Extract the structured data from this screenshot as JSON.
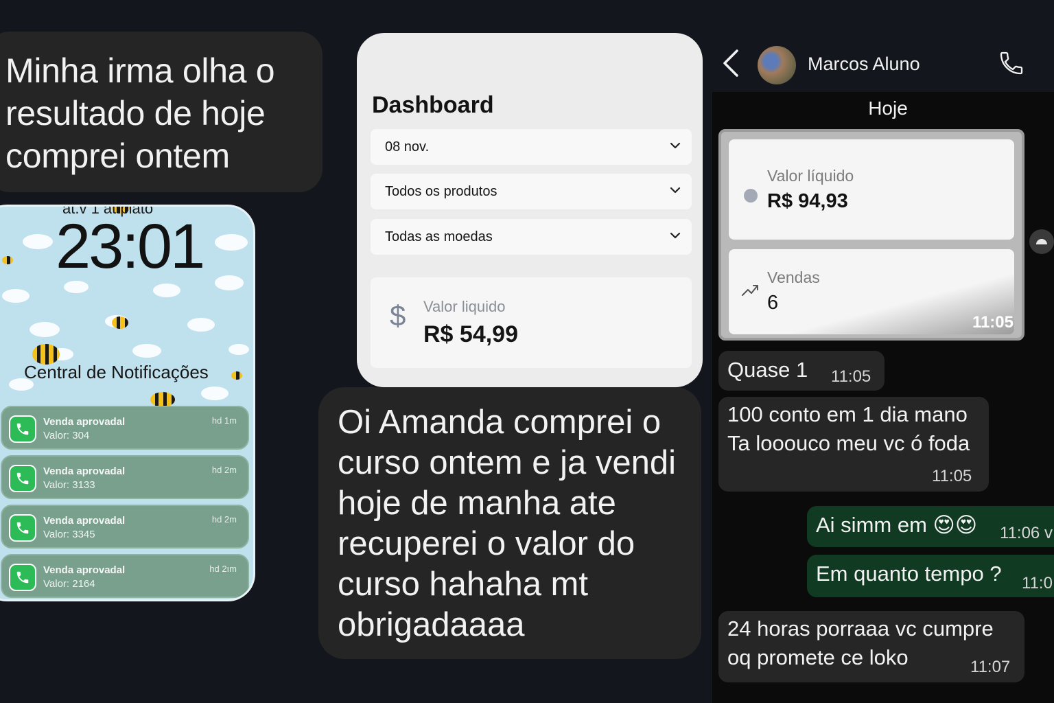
{
  "left_bubble": {
    "lines": [
      "Minha irma olha o",
      "resultado de hoje",
      "comprei ontem"
    ]
  },
  "lock_screen": {
    "date_partial": "at.v 1 at.plato",
    "time": "23:01",
    "notifications_title": "Central de Notificações",
    "notifications": [
      {
        "title": "Venda aprovadal",
        "value": "Valor: 304",
        "time": "hd 1m",
        "icon": "phone-icon"
      },
      {
        "title": "Venda aprovadal",
        "value": "Valor: 3133",
        "time": "hd 2m",
        "icon": "phone-icon"
      },
      {
        "title": "Venda aprovadal",
        "value": "Valor: 3345",
        "time": "hd 2m",
        "icon": "phone-icon"
      },
      {
        "title": "Venda aprovadal",
        "value": "Valor: 2164",
        "time": "hd 2ım",
        "icon": "phone-icon"
      }
    ]
  },
  "dashboard": {
    "title": "Dashboard",
    "filters": {
      "date": "08 nov.",
      "products": "Todos os produtos",
      "currencies": "Todas as moedas"
    },
    "value_card": {
      "icon": "$",
      "label": "Valor liquido",
      "amount": "R$ 54,99"
    }
  },
  "mid_bubble": {
    "lines": [
      "Oi Amanda comprei o",
      "curso ontem e ja vendi",
      "hoje de manha ate",
      "recuperei o valor do",
      "curso hahaha mt",
      "obrigadaaaa"
    ]
  },
  "chat": {
    "contact_name": "Marcos Aluno",
    "day_label": "Hoje",
    "image_message": {
      "net_label": "Valor líquido",
      "net_value": "R$ 94,93",
      "sales_label": "Vendas",
      "sales_value": "6",
      "time": "11:05"
    },
    "messages": [
      {
        "text": "Quase 1",
        "time": "11:05",
        "dir": "in"
      },
      {
        "line1": "100 conto em 1 dia mano",
        "line2": "Ta looouco meu vc ó foda",
        "time": "11:05",
        "dir": "in"
      },
      {
        "text": "Ai simm em 😍😍",
        "time": "11:06 v",
        "dir": "out"
      },
      {
        "text": "Em quanto tempo ?",
        "time": "11:0",
        "dir": "out"
      },
      {
        "line1": "24 horas porraaa vc cumpre",
        "line2": "oq promete ce loko",
        "time": "11:07",
        "dir": "in"
      }
    ]
  },
  "colors": {
    "background": "#13161d",
    "bubble": "#252526",
    "notification": "#78a08d",
    "whatsapp_green": "#2dbb57",
    "outgoing_bubble": "#103a22"
  }
}
